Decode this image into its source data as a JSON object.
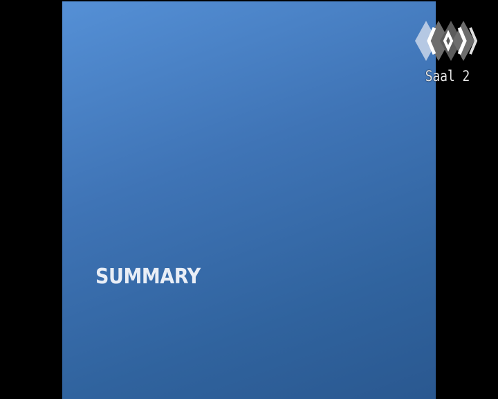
{
  "slide": {
    "title": "SUMMARY",
    "background_color": "#3f74b6"
  },
  "channel_logo": {
    "icon": "channel-logo-icon",
    "label": "Saal 2"
  }
}
